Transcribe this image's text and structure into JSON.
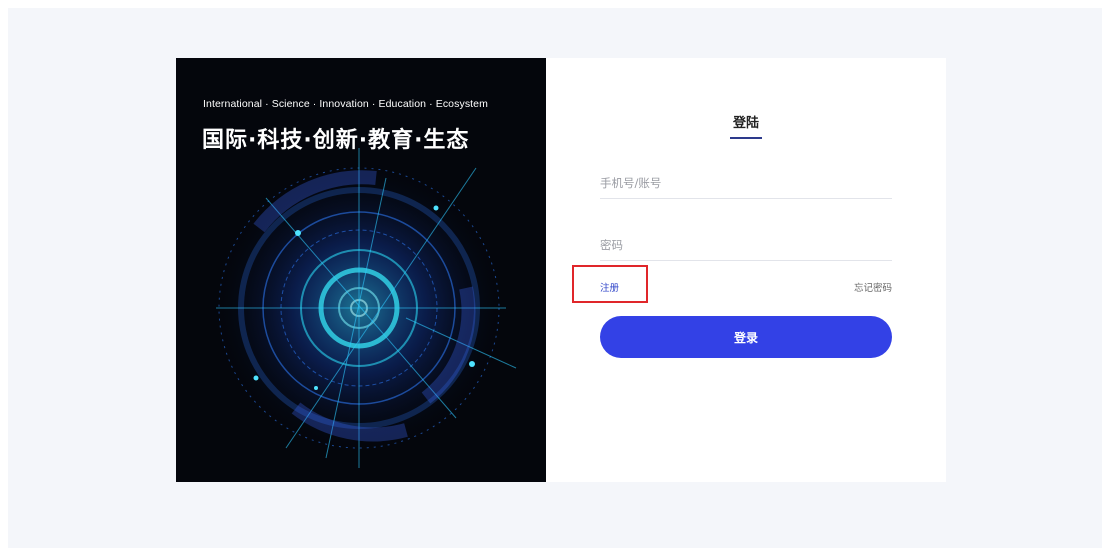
{
  "hero": {
    "subtitle_en": "International · Science · Innovation · Education · Ecosystem",
    "title_cn": "国际·科技·创新·教育·生态"
  },
  "login": {
    "tab_title": "登陆",
    "phone_placeholder": "手机号/账号",
    "password_placeholder": "密码",
    "register_link": "注册",
    "forgot_link": "忘记密码",
    "submit_label": "登录"
  },
  "colors": {
    "accent": "#3341e6",
    "highlight": "#e0262a",
    "hero_bg": "#04060c",
    "page_bg": "#f4f6fa"
  }
}
